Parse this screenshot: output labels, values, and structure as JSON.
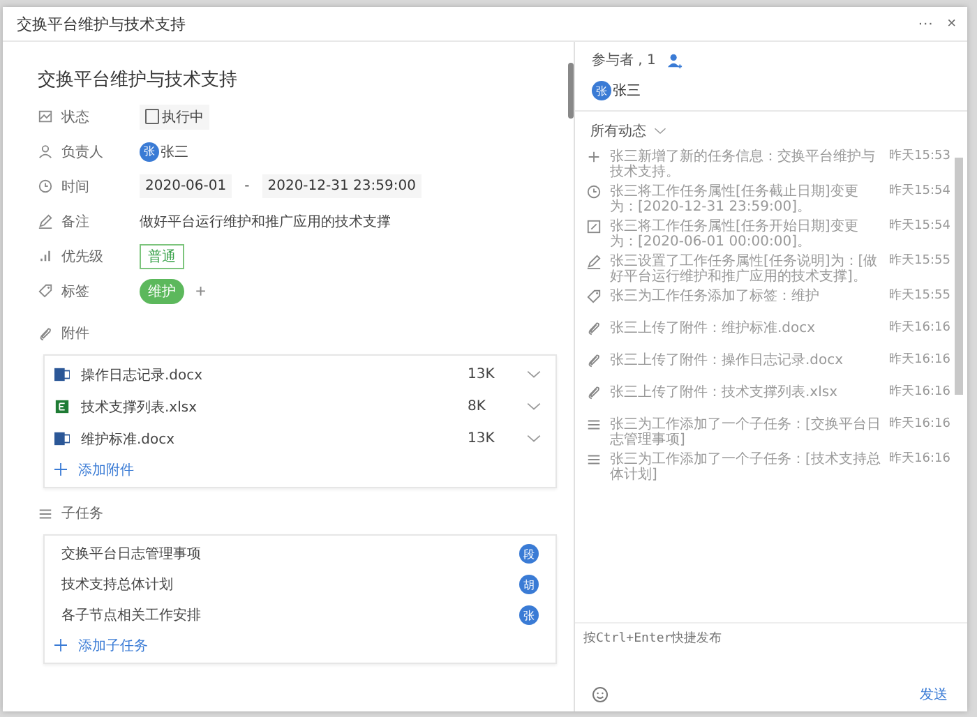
{
  "window": {
    "title": "交换平台维护与技术支持",
    "more": "···",
    "close": "×"
  },
  "task": {
    "title": "交换平台维护与技术支持",
    "fields": [
      {
        "kind": "status",
        "label": "状态",
        "value": "执行中",
        "checked": false
      },
      {
        "kind": "assignee",
        "label": "负责人",
        "avatar": "张",
        "value": "张三"
      },
      {
        "kind": "time",
        "label": "时间",
        "start": "2020-06-01",
        "separator": "-",
        "end": "2020-12-31 23:59:00"
      },
      {
        "kind": "note",
        "label": "备注",
        "value": "做好平台运行维护和推广应用的技术支撑"
      },
      {
        "kind": "priority",
        "label": "优先级",
        "value": "普通"
      },
      {
        "kind": "tags",
        "label": "标签",
        "tags": [
          "维护"
        ],
        "add": "+"
      }
    ]
  },
  "attachments": {
    "label": "附件",
    "files": [
      {
        "kind": "word",
        "name": "操作日志记录.docx",
        "size": "13K"
      },
      {
        "kind": "excel",
        "name": "技术支撑列表.xlsx",
        "size": "8K"
      },
      {
        "kind": "word",
        "name": "维护标准.docx",
        "size": "13K"
      }
    ],
    "add": "添加附件"
  },
  "subtasks": {
    "label": "子任务",
    "items": [
      {
        "name": "交换平台日志管理事项",
        "avatar": "段"
      },
      {
        "name": "技术支持总体计划",
        "avatar": "胡"
      },
      {
        "name": "各子节点相关工作安排",
        "avatar": "张"
      }
    ],
    "add": "添加子任务"
  },
  "participants": {
    "label": "参与者 , 1",
    "people": [
      {
        "avatar": "张",
        "name": "张三"
      }
    ]
  },
  "activity": {
    "filter": "所有动态",
    "items": [
      {
        "kind": "add",
        "text": "张三新增了新的任务信息：交换平台维护与技术支持。",
        "time": "昨天15:53"
      },
      {
        "kind": "clock",
        "text": "张三将工作任务属性[任务截止日期]变更为：[2020-12-31 23:59:00]。",
        "time": "昨天15:54"
      },
      {
        "kind": "edit",
        "text": "张三将工作任务属性[任务开始日期]变更为：[2020-06-01 00:00:00]。",
        "time": "昨天15:54"
      },
      {
        "kind": "pen",
        "text": "张三设置了工作任务属性[任务说明]为：[做好平台运行维护和推广应用的技术支撑]。",
        "time": "昨天15:55"
      },
      {
        "kind": "tag",
        "text": "张三为工作任务添加了标签：维护",
        "time": "昨天15:55"
      },
      {
        "kind": "attach",
        "text": "张三上传了附件：维护标准.docx",
        "time": "昨天16:16"
      },
      {
        "kind": "attach",
        "text": "张三上传了附件：操作日志记录.docx",
        "time": "昨天16:16"
      },
      {
        "kind": "attach",
        "text": "张三上传了附件：技术支撑列表.xlsx",
        "time": "昨天16:16"
      },
      {
        "kind": "list",
        "text": "张三为工作添加了一个子任务：[交换平台日志管理事项]",
        "time": "昨天16:16"
      },
      {
        "kind": "list",
        "text": "张三为工作添加了一个子任务：[技术支持总体计划]",
        "time": "昨天16:16"
      }
    ]
  },
  "comment": {
    "placeholder": "按Ctrl+Enter快捷发布",
    "send": "发送"
  }
}
